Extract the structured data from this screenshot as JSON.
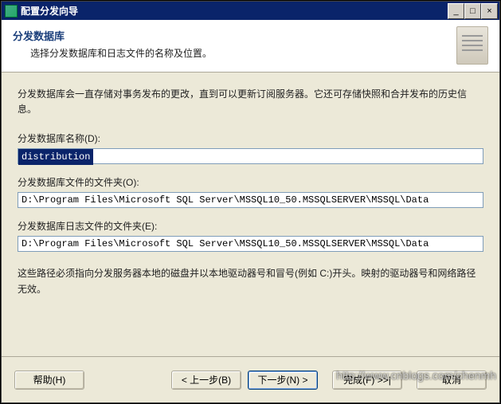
{
  "window": {
    "title": "配置分发向导"
  },
  "header": {
    "title": "分发数据库",
    "subtitle": "选择分发数据库和日志文件的名称及位置。"
  },
  "body": {
    "intro": "分发数据库会一直存储对事务发布的更改，直到可以更新订阅服务器。它还可存储快照和合并发布的历史信息。",
    "db_name_label": "分发数据库名称(D):",
    "db_name_value": "distribution",
    "db_folder_label": "分发数据库文件的文件夹(O):",
    "db_folder_value": "D:\\Program Files\\Microsoft SQL Server\\MSSQL10_50.MSSQLSERVER\\MSSQL\\Data",
    "log_folder_label": "分发数据库日志文件的文件夹(E):",
    "log_folder_value": "D:\\Program Files\\Microsoft SQL Server\\MSSQL10_50.MSSQLSERVER\\MSSQL\\Data",
    "note": "这些路径必须指向分发服务器本地的磁盘并以本地驱动器号和冒号(例如 C:)开头。映射的驱动器号和网络路径无效。"
  },
  "buttons": {
    "help": "帮助(H)",
    "back": "< 上一步(B)",
    "next": "下一步(N) >",
    "finish": "完成(F) >>|",
    "cancel": "取消"
  },
  "watermark": "http://www.cnblogs.com/chenmh"
}
